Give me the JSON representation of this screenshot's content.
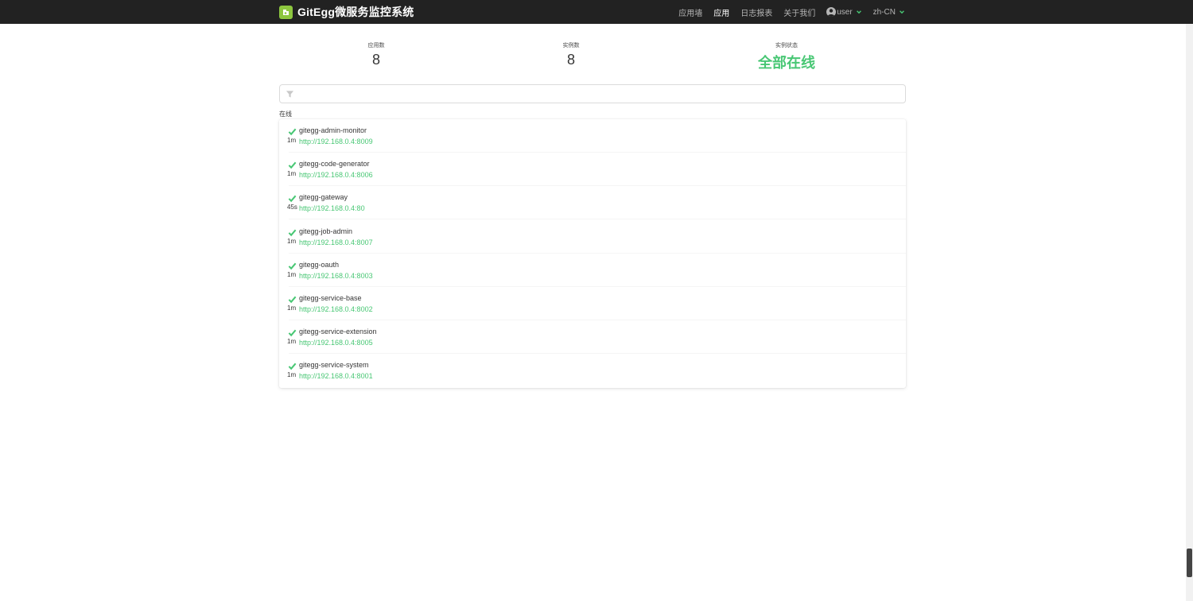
{
  "header": {
    "brand": "GitEgg微服务监控系统",
    "nav": [
      "应用墙",
      "应用",
      "日志报表",
      "关于我们"
    ],
    "active_nav": "应用",
    "user": "user",
    "language": "zh-CN"
  },
  "stats": {
    "apps_label": "应用数",
    "apps_value": "8",
    "instances_label": "实例数",
    "instances_value": "8",
    "status_label": "实例状态",
    "status_value": "全部在线"
  },
  "filter": {
    "placeholder": ""
  },
  "section": {
    "title": "在线"
  },
  "apps": [
    {
      "name": "gitegg-admin-monitor",
      "url": "http://192.168.0.4:8009",
      "age": "1m"
    },
    {
      "name": "gitegg-code-generator",
      "url": "http://192.168.0.4:8006",
      "age": "1m"
    },
    {
      "name": "gitegg-gateway",
      "url": "http://192.168.0.4:80",
      "age": "45s"
    },
    {
      "name": "gitegg-job-admin",
      "url": "http://192.168.0.4:8007",
      "age": "1m"
    },
    {
      "name": "gitegg-oauth",
      "url": "http://192.168.0.4:8003",
      "age": "1m"
    },
    {
      "name": "gitegg-service-base",
      "url": "http://192.168.0.4:8002",
      "age": "1m"
    },
    {
      "name": "gitegg-service-extension",
      "url": "http://192.168.0.4:8005",
      "age": "1m"
    },
    {
      "name": "gitegg-service-system",
      "url": "http://192.168.0.4:8001",
      "age": "1m"
    }
  ],
  "colors": {
    "navbar": "#222222",
    "accent_green": "#48c774",
    "logo_green": "#8dc63f"
  },
  "icons": [
    "app-logo-icon",
    "user-icon",
    "chevron-down-icon",
    "filter-icon",
    "check-icon"
  ]
}
